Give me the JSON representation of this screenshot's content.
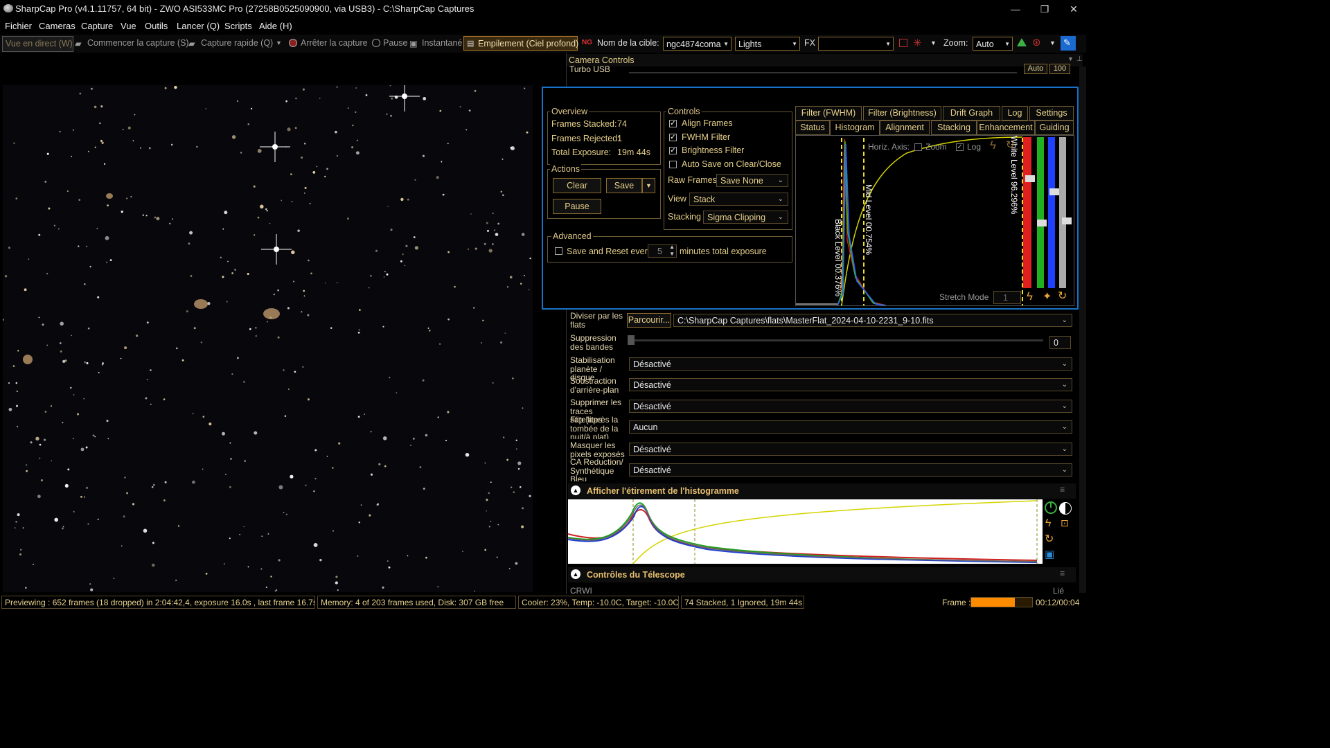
{
  "window": {
    "title": "SharpCap Pro (v4.1.11757, 64 bit) - ZWO ASI533MC Pro (27258B0525090900, via USB3) - C:\\SharpCap Captures",
    "minimize": "—",
    "maximize": "❐",
    "close": "✕"
  },
  "menu": [
    "Fichier",
    "Cameras",
    "Capture",
    "Vue",
    "Outils",
    "Lancer (Q)",
    "Scripts",
    "Aide (H)"
  ],
  "toolbar": {
    "live": "Vue en direct (W)",
    "start_capture": "Commencer la capture (S)",
    "quick_capture": "Capture rapide (Q)",
    "stop_capture": "Arrêter la capture",
    "pause": "Pause",
    "snapshot": "Instantané",
    "stacking": "Empilement (Ciel profond)",
    "target_label": "Nom de la cible:",
    "target_value": "ngc4874coma",
    "frame_type": "Lights",
    "fx_label": "FX",
    "fx_value": "",
    "zoom_label": "Zoom:",
    "zoom_value": "Auto"
  },
  "camera_controls": {
    "title": "Camera Controls",
    "turbo_label": "Turbo USB",
    "turbo_auto": "Auto",
    "turbo_value": "100"
  },
  "stacking": {
    "overview": {
      "title": "Overview",
      "frames_stacked_label": "Frames Stacked:",
      "frames_stacked": "74",
      "frames_rejected_label": "Frames Rejected:",
      "frames_rejected": "1",
      "total_exposure_label": "Total Exposure:",
      "total_exposure": "19m 44s"
    },
    "actions": {
      "title": "Actions",
      "clear": "Clear",
      "save": "Save",
      "pause": "Pause"
    },
    "advanced": {
      "title": "Advanced",
      "save_reset_label": "Save and Reset every",
      "save_reset_value": "5",
      "save_reset_suffix": "minutes total exposure"
    },
    "controls": {
      "title": "Controls",
      "align_frames": "Align Frames",
      "fwhm_filter": "FWHM Filter",
      "brightness_filter": "Brightness Filter",
      "auto_save": "Auto Save on Clear/Close",
      "raw_frames_label": "Raw Frames",
      "raw_frames_value": "Save None",
      "view_label": "View",
      "view_value": "Stack",
      "stacking_label": "Stacking",
      "stacking_value": "Sigma Clipping"
    },
    "tabs_row1": [
      "Filter (FWHM)",
      "Filter (Brightness)",
      "Drift Graph",
      "Log",
      "Settings"
    ],
    "tabs_row2": [
      "Status",
      "Histogram",
      "Alignment",
      "Stacking",
      "Enhancement",
      "Guiding"
    ],
    "histogram": {
      "horiz_axis": "Horiz. Axis:",
      "zoom": "Zoom",
      "log": "Log",
      "black_level": "Black Level 00.376%",
      "mid_level": "Mid Level 00.754%",
      "white_level": "White Level 96.296%",
      "stretch_mode": "Stretch Mode",
      "stretch_value": "1"
    }
  },
  "processing": {
    "rows": [
      {
        "label": "Diviser par les flats",
        "browse": "Parcourir...",
        "value": "C:\\SharpCap Captures\\flats\\MasterFlat_2024-04-10-2231_9-10.fits"
      },
      {
        "label": "Suppression des bandes",
        "value": "0"
      },
      {
        "label": "Stabilisation planète / disque",
        "value": "Désactivé"
      },
      {
        "label": "Soustraction d'arrière-plan",
        "value": "Désactivé"
      },
      {
        "label": "Supprimer les traces satellites",
        "value": "Désactivé"
      },
      {
        "label": "Flip (après la tombée de la nuit/à plat)",
        "value": "Aucun"
      },
      {
        "label": "Masquer les pixels exposés",
        "value": "Désactivé"
      },
      {
        "label": "CA Reduction/ Synthétique Bleu",
        "value": "Désactivé"
      }
    ]
  },
  "histogram_stretch": {
    "title": "Afficher l'étirement de l'histogramme"
  },
  "telescope": {
    "title": "Contrôles du Télescope",
    "sub_left": "CRWI",
    "sub_right": "Lié"
  },
  "status": {
    "preview": "Previewing : 652 frames (18 dropped) in 2:04:42,4, exposure 16.0s , last frame 16.7s",
    "memory": "Memory: 4 of 203 frames used, Disk: 307 GB free",
    "cooler": "Cooler: 23%, Temp: -10.0C, Target: -10.0C",
    "stacked": "74 Stacked, 1 Ignored, 19m 44s",
    "frame_label": "Frame :",
    "frame_progress": 0.72,
    "frame_time": "00:12/00:04"
  },
  "colors": {
    "accent_orange": "#e8a33a",
    "border_blue": "#1a73c8",
    "progress": "#ff8c00"
  }
}
